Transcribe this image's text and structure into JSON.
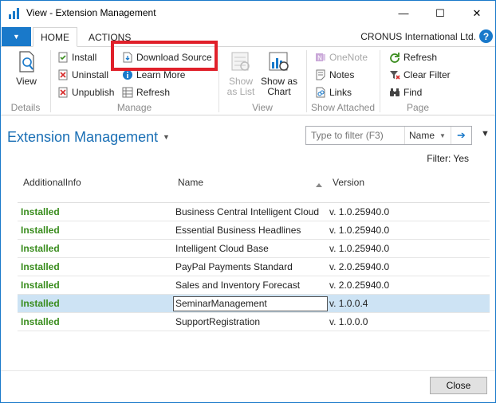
{
  "window": {
    "title": "View - Extension Management",
    "minimize": "—",
    "maximize": "☐",
    "close": "✕"
  },
  "ribbon_tabs": {
    "app_menu": "▼",
    "home": "HOME",
    "actions": "ACTIONS",
    "company": "CRONUS International Ltd.",
    "help": "?"
  },
  "groups": {
    "details": {
      "label": "Details",
      "view": "View"
    },
    "manage": {
      "label": "Manage",
      "install": "Install",
      "uninstall": "Uninstall",
      "unpublish": "Unpublish",
      "download_source": "Download Source",
      "learn_more": "Learn More",
      "refresh": "Refresh"
    },
    "view": {
      "label": "View",
      "show_as_list": [
        "Show",
        "as List"
      ],
      "show_as_chart": [
        "Show as",
        "Chart"
      ]
    },
    "show_attached": {
      "label": "Show Attached",
      "onenote": "OneNote",
      "notes": "Notes",
      "links": "Links"
    },
    "page": {
      "label": "Page",
      "refresh": "Refresh",
      "clear_filter": "Clear Filter",
      "find": "Find"
    }
  },
  "page": {
    "title": "Extension Management",
    "filter_placeholder": "Type to filter (F3)",
    "filter_field": "Name",
    "filter_status": "Filter: Yes"
  },
  "columns": {
    "additional_info": "AdditionalInfo",
    "name": "Name",
    "version": "Version"
  },
  "rows": [
    {
      "status": "Installed",
      "name": "Business Central Intelligent Cloud",
      "version": "v. 1.0.25940.0"
    },
    {
      "status": "Installed",
      "name": "Essential Business Headlines",
      "version": "v. 1.0.25940.0"
    },
    {
      "status": "Installed",
      "name": "Intelligent Cloud Base",
      "version": "v. 1.0.25940.0"
    },
    {
      "status": "Installed",
      "name": "PayPal Payments Standard",
      "version": "v. 2.0.25940.0"
    },
    {
      "status": "Installed",
      "name": "Sales and Inventory Forecast",
      "version": "v. 2.0.25940.0"
    },
    {
      "status": "Installed",
      "name": "SeminarManagement",
      "version": "v. 1.0.0.4"
    },
    {
      "status": "Installed",
      "name": "SupportRegistration",
      "version": "v. 1.0.0.0"
    }
  ],
  "footer": {
    "close": "Close"
  },
  "colors": {
    "accent": "#1979ca",
    "installed": "#3a8d1e",
    "selected_row": "#cde3f4",
    "highlight": "#e0202a"
  }
}
